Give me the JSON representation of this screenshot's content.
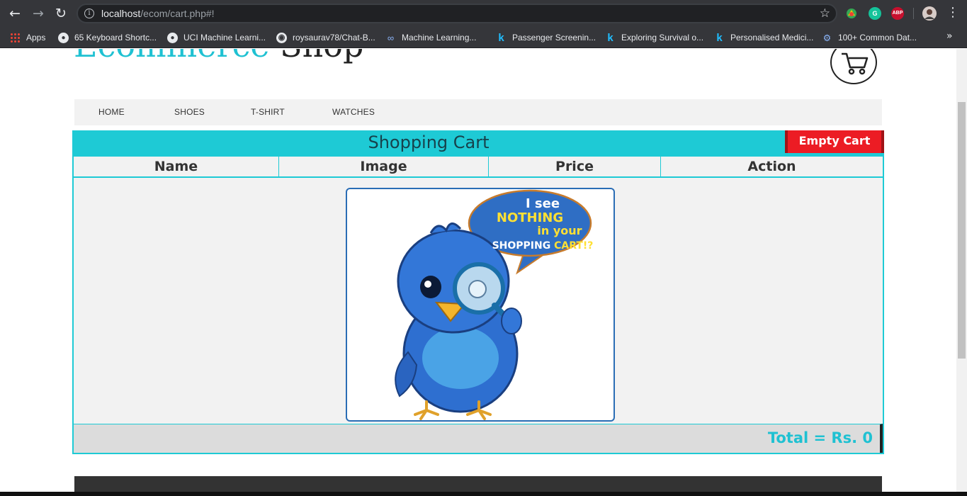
{
  "browser": {
    "url_host": "localhost",
    "url_path": "/ecom/cart.php#!",
    "bookmarks": [
      {
        "label": "Apps",
        "icon": "apps-grid-icon"
      },
      {
        "label": "65 Keyboard Shortc...",
        "icon": "globe-icon"
      },
      {
        "label": "UCI Machine Learni...",
        "icon": "globe-icon"
      },
      {
        "label": "roysaurav78/Chat-B...",
        "icon": "github-icon"
      },
      {
        "label": "Machine Learning...",
        "icon": "coursera-icon"
      },
      {
        "label": "Passenger Screenin...",
        "icon": "kaggle-icon"
      },
      {
        "label": "Exploring Survival o...",
        "icon": "kaggle-icon"
      },
      {
        "label": "Personalised Medici...",
        "icon": "kaggle-icon"
      },
      {
        "label": "100+ Common Dat...",
        "icon": "gear-icon"
      }
    ],
    "extensions": {
      "grammarly": "G",
      "adblock": "ABP"
    }
  },
  "site": {
    "brand_part1": "Ecommerce",
    "brand_part2": "Shop"
  },
  "nav": {
    "items": [
      "HOME",
      "SHOES",
      "T-SHIRT",
      "WATCHES"
    ]
  },
  "cart": {
    "title": "Shopping Cart",
    "empty_button": "Empty Cart",
    "columns": [
      "Name",
      "Image",
      "Price",
      "Action"
    ],
    "total_text": "Total = Rs. 0",
    "empty_image": {
      "line1": "I see",
      "line2": "NOTHING",
      "line3": "in your",
      "line4a": "SHOPPING ",
      "line4b": "CART!?"
    }
  },
  "colors": {
    "accent": "#1ecad5",
    "danger": "#ec1c24",
    "chrome": "#35363a"
  }
}
